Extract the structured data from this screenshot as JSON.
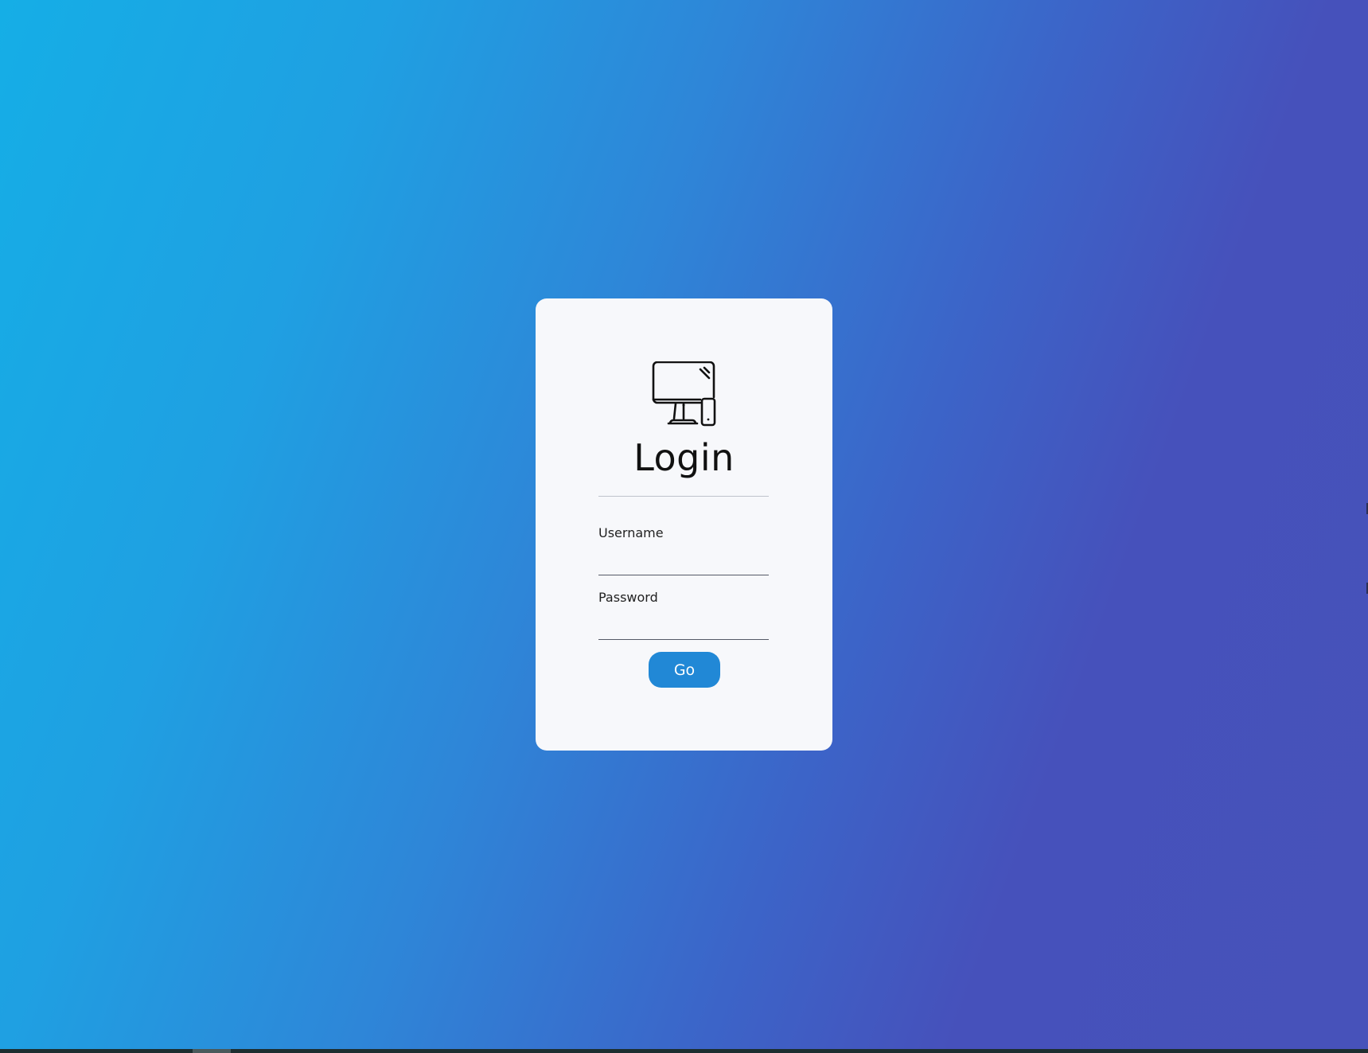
{
  "page": {
    "background_colors": [
      "#15aee6",
      "#4752ba"
    ]
  },
  "login_card": {
    "logo_icon": "desktop-and-phone-icon",
    "title": "Login",
    "username": {
      "label": "Username",
      "value": "",
      "placeholder": ""
    },
    "password": {
      "label": "Password",
      "value": "",
      "placeholder": ""
    },
    "submit_label": "Go",
    "accent_color": "#2188d6"
  }
}
